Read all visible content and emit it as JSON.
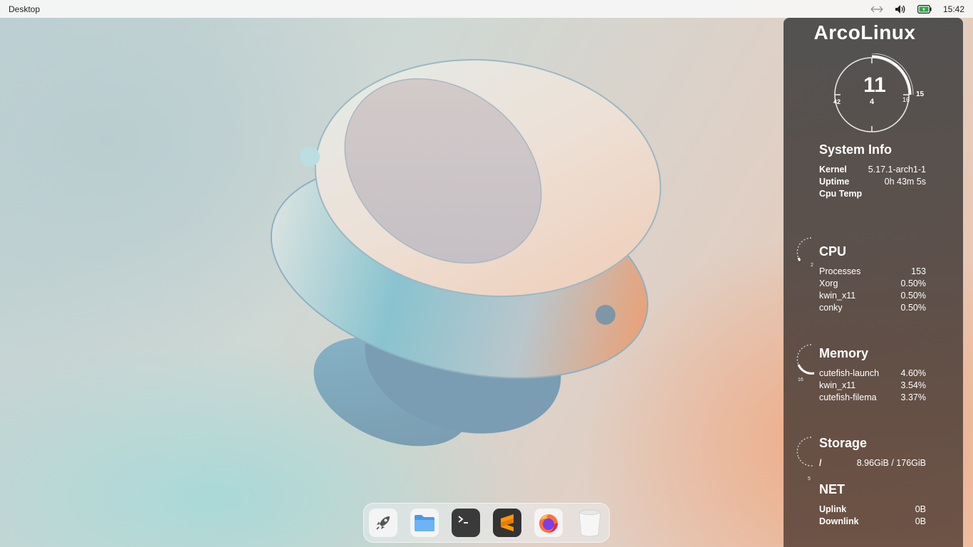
{
  "top_panel": {
    "title": "Desktop",
    "clock": "15:42",
    "icons": [
      "network-icon",
      "volume-icon",
      "battery-icon"
    ]
  },
  "conky": {
    "brand": "ArcoLinux",
    "clock": {
      "hour": "11",
      "minute": "4",
      "minute_glyph": "",
      "day_glyph": "",
      "left_label": "42",
      "right_label": "16",
      "outer_label": "15"
    },
    "system_info": {
      "title": "System Info",
      "rows": [
        {
          "key": "Kernel",
          "value": "5.17.1-arch1-1"
        },
        {
          "key": "Uptime",
          "value": "0h 43m 5s"
        },
        {
          "key": "Cpu Temp",
          "value": ""
        }
      ]
    },
    "cpu": {
      "title": "CPU",
      "gauge_label": "2",
      "rows": [
        {
          "key": "Processes",
          "value": "153"
        },
        {
          "key": "Xorg",
          "value": "0.50%"
        },
        {
          "key": "kwin_x11",
          "value": "0.50%"
        },
        {
          "key": "conky",
          "value": "0.50%"
        }
      ]
    },
    "memory": {
      "title": "Memory",
      "gauge_label": "16",
      "rows": [
        {
          "key": "cutefish-launch",
          "value": "4.60%"
        },
        {
          "key": "kwin_x11",
          "value": "3.54%"
        },
        {
          "key": "cutefish-filema",
          "value": "3.37%"
        }
      ]
    },
    "storage": {
      "title": "Storage",
      "gauge_label": "5",
      "rows": [
        {
          "key": "/",
          "value": "8.96GiB / 176GiB"
        }
      ]
    },
    "net": {
      "title": "NET",
      "rows": [
        {
          "key": "Uplink",
          "value": "0B"
        },
        {
          "key": "Downlink",
          "value": "0B"
        }
      ]
    }
  },
  "dock": {
    "apps": [
      "launcher-icon",
      "file-manager-icon",
      "terminal-icon",
      "sublime-text-icon",
      "firefox-icon",
      "trash-icon"
    ]
  },
  "colors": {
    "panel_bg": "#f5f5f5",
    "conky_bg": "#484848",
    "terminal": "#3a3a3a",
    "sublime": "#ff9800",
    "folder": "#5aa7f0"
  }
}
